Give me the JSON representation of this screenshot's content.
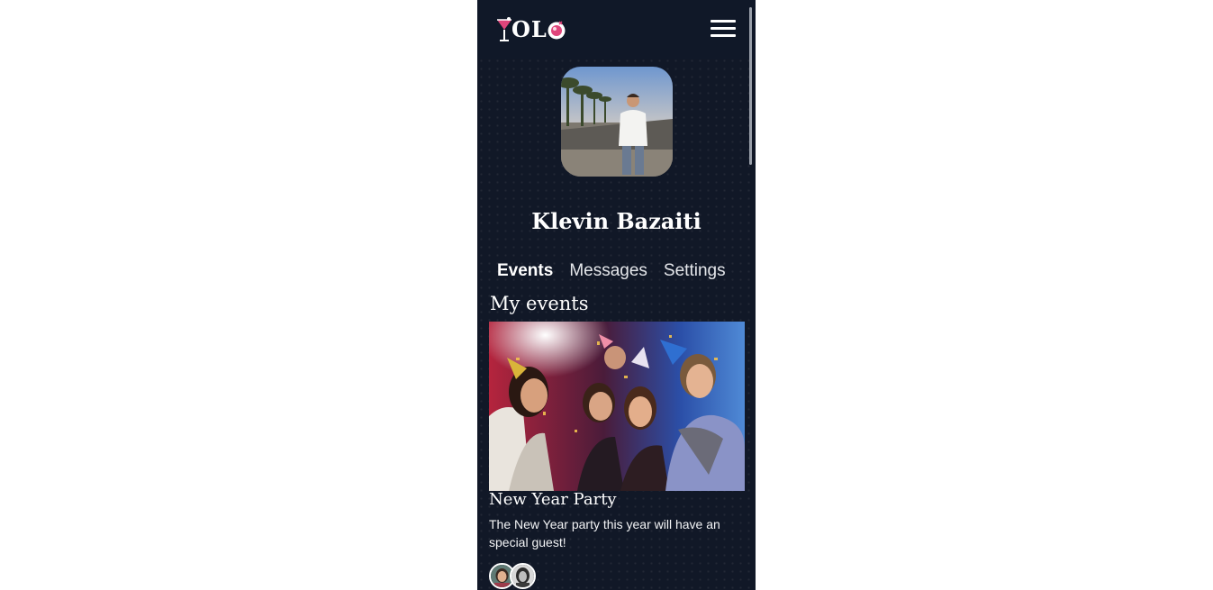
{
  "app": {
    "logo_text": "OL",
    "logo_icons": [
      "cocktail-glass-icon",
      "disco-ball-icon"
    ]
  },
  "header": {
    "menu_icon": "hamburger-menu-icon"
  },
  "profile": {
    "name": "Klevin Bazaiti"
  },
  "tabs": [
    {
      "label": "Events",
      "active": true
    },
    {
      "label": "Messages",
      "active": false
    },
    {
      "label": "Settings",
      "active": false
    }
  ],
  "events_section": {
    "title": "My events",
    "events": [
      {
        "title": "New Year Party",
        "description": "The New Year party this year will have an special guest!",
        "attendee_count": 2
      }
    ]
  },
  "colors": {
    "background": "#111827",
    "page": "#ffffff",
    "text": "#ffffff",
    "accent_pink": "#e0457b"
  }
}
